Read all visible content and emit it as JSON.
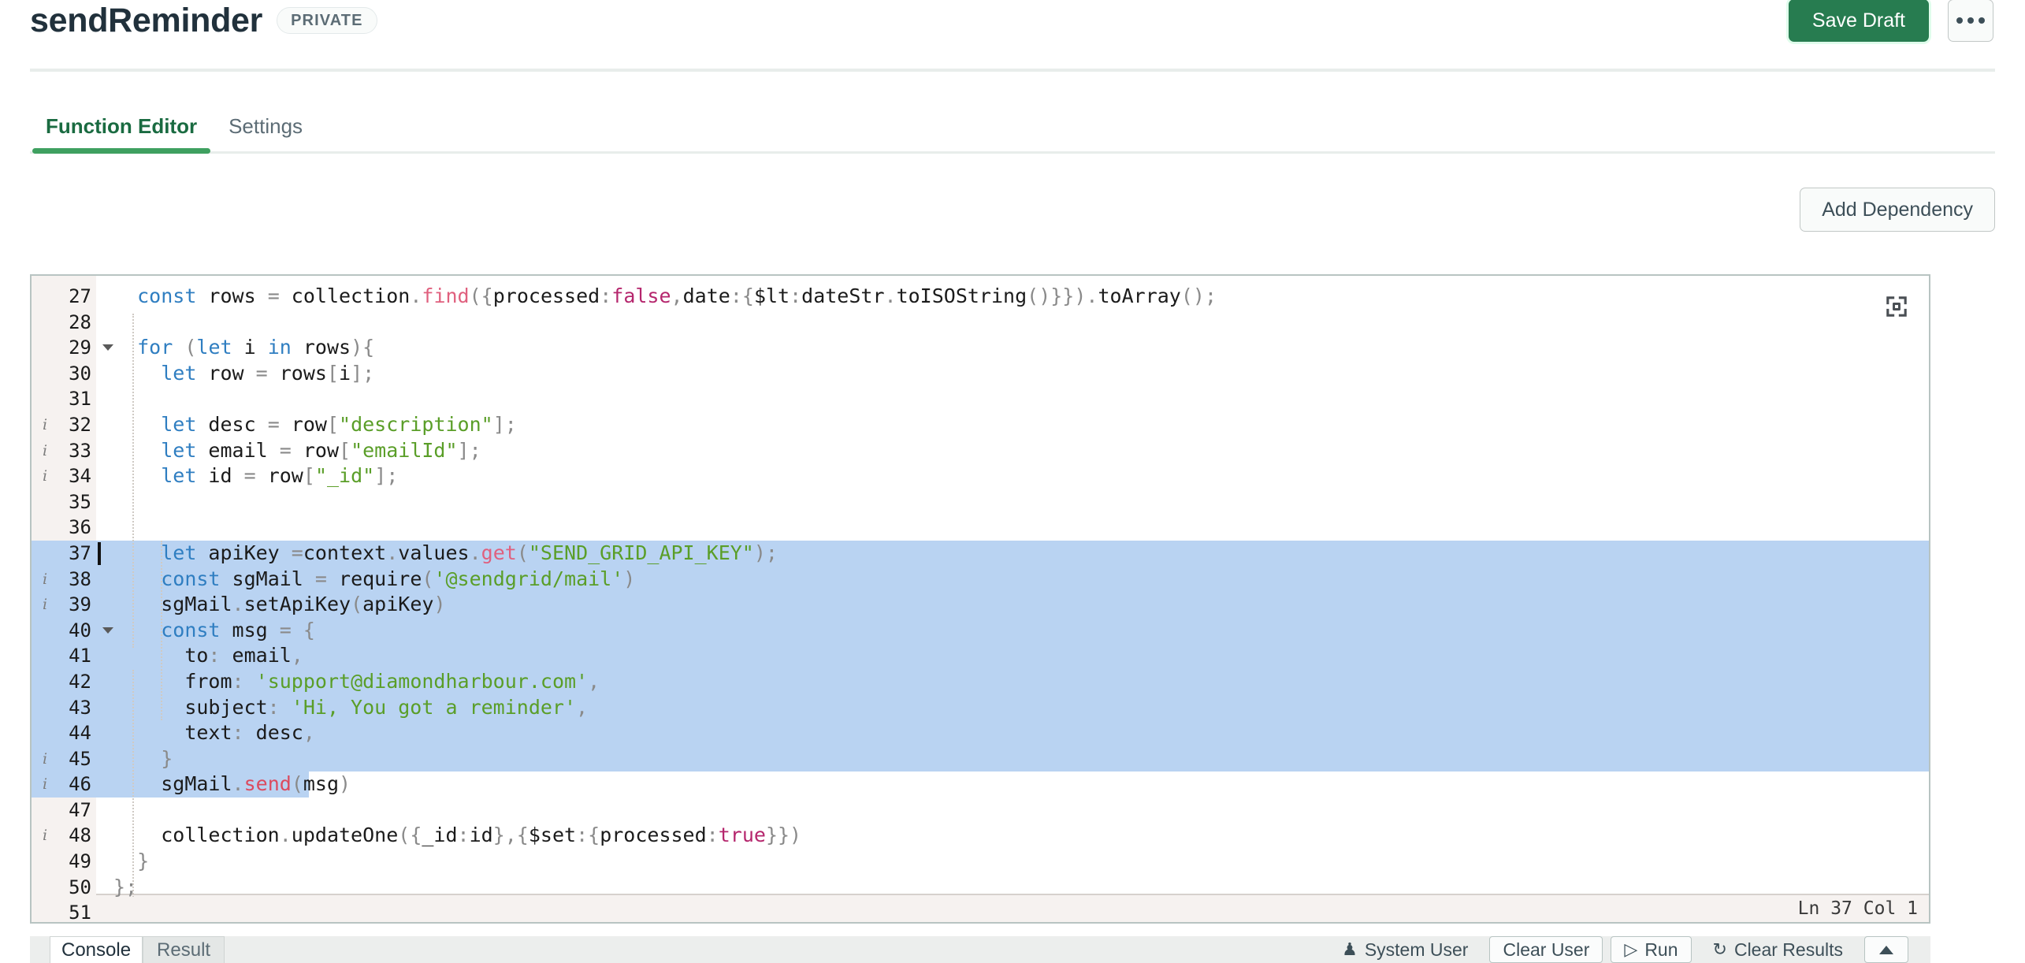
{
  "header": {
    "title": "sendReminder",
    "badge": "PRIVATE",
    "save_draft_label": "Save Draft",
    "more_icon": "ellipsis-icon"
  },
  "tabs": [
    {
      "label": "Function Editor",
      "active": true
    },
    {
      "label": "Settings",
      "active": false
    }
  ],
  "toolbar": {
    "add_dependency_label": "Add Dependency"
  },
  "editor": {
    "status": "Ln 37 Col 1",
    "cursor_line": 37,
    "cursor_col": 1,
    "selection_start_line": 37,
    "selection_end_line": 46,
    "first_visible_line": 27,
    "last_visible_line": 51,
    "expand_icon": "expand-corners-icon",
    "selection_color": "#b9d3f2",
    "gutter_color": "#f6f2f0",
    "lines": [
      {
        "n": 27,
        "info": false,
        "fold": false,
        "sel": false,
        "tokens": [
          {
            "t": "  ",
            "c": "plain"
          },
          {
            "t": "const",
            "c": "kw"
          },
          {
            "t": " rows ",
            "c": "plain"
          },
          {
            "t": "=",
            "c": "punc"
          },
          {
            "t": " collection",
            "c": "plain"
          },
          {
            "t": ".",
            "c": "punc"
          },
          {
            "t": "find",
            "c": "fn"
          },
          {
            "t": "(",
            "c": "punc"
          },
          {
            "t": "{",
            "c": "punc"
          },
          {
            "t": "processed",
            "c": "plain"
          },
          {
            "t": ":",
            "c": "punc"
          },
          {
            "t": "false",
            "c": "num"
          },
          {
            "t": ",",
            "c": "punc"
          },
          {
            "t": "date",
            "c": "plain"
          },
          {
            "t": ":",
            "c": "punc"
          },
          {
            "t": "{",
            "c": "punc"
          },
          {
            "t": "$lt",
            "c": "plain"
          },
          {
            "t": ":",
            "c": "punc"
          },
          {
            "t": "dateStr",
            "c": "plain"
          },
          {
            "t": ".",
            "c": "punc"
          },
          {
            "t": "toISOString",
            "c": "plain"
          },
          {
            "t": "()}})",
            "c": "punc"
          },
          {
            "t": ".",
            "c": "punc"
          },
          {
            "t": "toArray",
            "c": "plain"
          },
          {
            "t": "()",
            "c": "punc"
          },
          {
            "t": ";",
            "c": "punc"
          }
        ]
      },
      {
        "n": 28,
        "info": false,
        "fold": false,
        "sel": false,
        "tokens": []
      },
      {
        "n": 29,
        "info": false,
        "fold": true,
        "sel": false,
        "tokens": [
          {
            "t": "  ",
            "c": "plain"
          },
          {
            "t": "for",
            "c": "kw"
          },
          {
            "t": " ",
            "c": "plain"
          },
          {
            "t": "(",
            "c": "punc"
          },
          {
            "t": "let",
            "c": "kw"
          },
          {
            "t": " i ",
            "c": "plain"
          },
          {
            "t": "in",
            "c": "kw"
          },
          {
            "t": " rows",
            "c": "plain"
          },
          {
            "t": "){",
            "c": "punc"
          }
        ]
      },
      {
        "n": 30,
        "info": false,
        "fold": false,
        "sel": false,
        "tokens": [
          {
            "t": "    ",
            "c": "plain"
          },
          {
            "t": "let",
            "c": "kw"
          },
          {
            "t": " row ",
            "c": "plain"
          },
          {
            "t": "=",
            "c": "punc"
          },
          {
            "t": " rows",
            "c": "plain"
          },
          {
            "t": "[",
            "c": "punc"
          },
          {
            "t": "i",
            "c": "plain"
          },
          {
            "t": "];",
            "c": "punc"
          }
        ]
      },
      {
        "n": 31,
        "info": false,
        "fold": false,
        "sel": false,
        "tokens": []
      },
      {
        "n": 32,
        "info": true,
        "fold": false,
        "sel": false,
        "tokens": [
          {
            "t": "    ",
            "c": "plain"
          },
          {
            "t": "let",
            "c": "kw"
          },
          {
            "t": " desc ",
            "c": "plain"
          },
          {
            "t": "=",
            "c": "punc"
          },
          {
            "t": " row",
            "c": "plain"
          },
          {
            "t": "[",
            "c": "punc"
          },
          {
            "t": "\"description\"",
            "c": "str"
          },
          {
            "t": "];",
            "c": "punc"
          }
        ]
      },
      {
        "n": 33,
        "info": true,
        "fold": false,
        "sel": false,
        "tokens": [
          {
            "t": "    ",
            "c": "plain"
          },
          {
            "t": "let",
            "c": "kw"
          },
          {
            "t": " email ",
            "c": "plain"
          },
          {
            "t": "=",
            "c": "punc"
          },
          {
            "t": " row",
            "c": "plain"
          },
          {
            "t": "[",
            "c": "punc"
          },
          {
            "t": "\"emailId\"",
            "c": "str"
          },
          {
            "t": "];",
            "c": "punc"
          }
        ]
      },
      {
        "n": 34,
        "info": true,
        "fold": false,
        "sel": false,
        "tokens": [
          {
            "t": "    ",
            "c": "plain"
          },
          {
            "t": "let",
            "c": "kw"
          },
          {
            "t": " id ",
            "c": "plain"
          },
          {
            "t": "=",
            "c": "punc"
          },
          {
            "t": " row",
            "c": "plain"
          },
          {
            "t": "[",
            "c": "punc"
          },
          {
            "t": "\"_id\"",
            "c": "str"
          },
          {
            "t": "];",
            "c": "punc"
          }
        ]
      },
      {
        "n": 35,
        "info": false,
        "fold": false,
        "sel": false,
        "tokens": []
      },
      {
        "n": 36,
        "info": false,
        "fold": false,
        "sel": false,
        "tokens": []
      },
      {
        "n": 37,
        "info": false,
        "fold": false,
        "sel": true,
        "caret": true,
        "tokens": [
          {
            "t": "    ",
            "c": "plain"
          },
          {
            "t": "let",
            "c": "kw"
          },
          {
            "t": " apiKey ",
            "c": "plain"
          },
          {
            "t": "=",
            "c": "punc"
          },
          {
            "t": "context",
            "c": "plain"
          },
          {
            "t": ".",
            "c": "punc"
          },
          {
            "t": "values",
            "c": "plain"
          },
          {
            "t": ".",
            "c": "punc"
          },
          {
            "t": "get",
            "c": "fn"
          },
          {
            "t": "(",
            "c": "punc"
          },
          {
            "t": "\"SEND_GRID_API_KEY\"",
            "c": "str"
          },
          {
            "t": ")",
            "c": "punc"
          },
          {
            "t": ";",
            "c": "punc"
          }
        ]
      },
      {
        "n": 38,
        "info": true,
        "fold": false,
        "sel": true,
        "tokens": [
          {
            "t": "    ",
            "c": "plain"
          },
          {
            "t": "const",
            "c": "kw"
          },
          {
            "t": " sgMail ",
            "c": "plain"
          },
          {
            "t": "=",
            "c": "punc"
          },
          {
            "t": " require",
            "c": "plain"
          },
          {
            "t": "(",
            "c": "punc"
          },
          {
            "t": "'@sendgrid/mail'",
            "c": "str"
          },
          {
            "t": ")",
            "c": "punc"
          }
        ]
      },
      {
        "n": 39,
        "info": true,
        "fold": false,
        "sel": true,
        "tokens": [
          {
            "t": "    ",
            "c": "plain"
          },
          {
            "t": "sgMail",
            "c": "plain"
          },
          {
            "t": ".",
            "c": "punc"
          },
          {
            "t": "setApiKey",
            "c": "plain"
          },
          {
            "t": "(",
            "c": "punc"
          },
          {
            "t": "apiKey",
            "c": "plain"
          },
          {
            "t": ")",
            "c": "punc"
          }
        ]
      },
      {
        "n": 40,
        "info": false,
        "fold": true,
        "sel": true,
        "tokens": [
          {
            "t": "    ",
            "c": "plain"
          },
          {
            "t": "const",
            "c": "kw"
          },
          {
            "t": " msg ",
            "c": "plain"
          },
          {
            "t": "=",
            "c": "punc"
          },
          {
            "t": " ",
            "c": "plain"
          },
          {
            "t": "{",
            "c": "punc"
          }
        ]
      },
      {
        "n": 41,
        "info": false,
        "fold": false,
        "sel": true,
        "tokens": [
          {
            "t": "      ",
            "c": "plain"
          },
          {
            "t": "to",
            "c": "plain"
          },
          {
            "t": ":",
            "c": "punc"
          },
          {
            "t": " email",
            "c": "plain"
          },
          {
            "t": ",",
            "c": "punc"
          }
        ]
      },
      {
        "n": 42,
        "info": false,
        "fold": false,
        "sel": true,
        "tokens": [
          {
            "t": "      ",
            "c": "plain"
          },
          {
            "t": "from",
            "c": "plain"
          },
          {
            "t": ":",
            "c": "punc"
          },
          {
            "t": " ",
            "c": "plain"
          },
          {
            "t": "'support@diamondharbour.com'",
            "c": "str"
          },
          {
            "t": ",",
            "c": "punc"
          }
        ]
      },
      {
        "n": 43,
        "info": false,
        "fold": false,
        "sel": true,
        "tokens": [
          {
            "t": "      ",
            "c": "plain"
          },
          {
            "t": "subject",
            "c": "plain"
          },
          {
            "t": ":",
            "c": "punc"
          },
          {
            "t": " ",
            "c": "plain"
          },
          {
            "t": "'Hi, You got a reminder'",
            "c": "str"
          },
          {
            "t": ",",
            "c": "punc"
          }
        ]
      },
      {
        "n": 44,
        "info": false,
        "fold": false,
        "sel": true,
        "tokens": [
          {
            "t": "      ",
            "c": "plain"
          },
          {
            "t": "text",
            "c": "plain"
          },
          {
            "t": ":",
            "c": "punc"
          },
          {
            "t": " desc",
            "c": "plain"
          },
          {
            "t": ",",
            "c": "punc"
          }
        ]
      },
      {
        "n": 45,
        "info": true,
        "fold": false,
        "sel": true,
        "tokens": [
          {
            "t": "    ",
            "c": "plain"
          },
          {
            "t": "}",
            "c": "punc"
          }
        ]
      },
      {
        "n": 46,
        "info": true,
        "fold": false,
        "sel": true,
        "partial": 270,
        "tokens": [
          {
            "t": "    ",
            "c": "plain"
          },
          {
            "t": "sgMail",
            "c": "plain"
          },
          {
            "t": ".",
            "c": "punc"
          },
          {
            "t": "send",
            "c": "fnr"
          },
          {
            "t": "(",
            "c": "punc"
          },
          {
            "t": "msg",
            "c": "plain"
          },
          {
            "t": ")",
            "c": "punc"
          }
        ]
      },
      {
        "n": 47,
        "info": false,
        "fold": false,
        "sel": false,
        "tokens": []
      },
      {
        "n": 48,
        "info": true,
        "fold": false,
        "sel": false,
        "tokens": [
          {
            "t": "    ",
            "c": "plain"
          },
          {
            "t": "collection",
            "c": "plain"
          },
          {
            "t": ".",
            "c": "punc"
          },
          {
            "t": "updateOne",
            "c": "plain"
          },
          {
            "t": "({",
            "c": "punc"
          },
          {
            "t": "_id",
            "c": "plain"
          },
          {
            "t": ":",
            "c": "punc"
          },
          {
            "t": "id",
            "c": "plain"
          },
          {
            "t": "},{",
            "c": "punc"
          },
          {
            "t": "$set",
            "c": "plain"
          },
          {
            "t": ":",
            "c": "punc"
          },
          {
            "t": "{",
            "c": "punc"
          },
          {
            "t": "processed",
            "c": "plain"
          },
          {
            "t": ":",
            "c": "punc"
          },
          {
            "t": "true",
            "c": "num"
          },
          {
            "t": "}})",
            "c": "punc"
          }
        ]
      },
      {
        "n": 49,
        "info": false,
        "fold": false,
        "sel": false,
        "tokens": [
          {
            "t": "  ",
            "c": "plain"
          },
          {
            "t": "}",
            "c": "punc"
          }
        ]
      },
      {
        "n": 50,
        "info": false,
        "fold": false,
        "sel": false,
        "tokens": [
          {
            "t": "};",
            "c": "punc"
          }
        ]
      },
      {
        "n": 51,
        "info": false,
        "fold": false,
        "sel": false,
        "tokens": []
      }
    ]
  },
  "bottom_panel": {
    "tabs": [
      {
        "label": "Console",
        "active": true
      },
      {
        "label": "Result",
        "active": false
      }
    ],
    "actions": [
      {
        "label": "System User",
        "icon": "user-icon",
        "style": "plain"
      },
      {
        "label": "Clear User",
        "icon": "",
        "style": "bordered"
      },
      {
        "label": "Run",
        "icon": "play-icon",
        "style": "bordered"
      },
      {
        "label": "Clear Results",
        "icon": "refresh-icon",
        "style": "plain"
      }
    ],
    "caret_icon": "caret-up-icon"
  }
}
